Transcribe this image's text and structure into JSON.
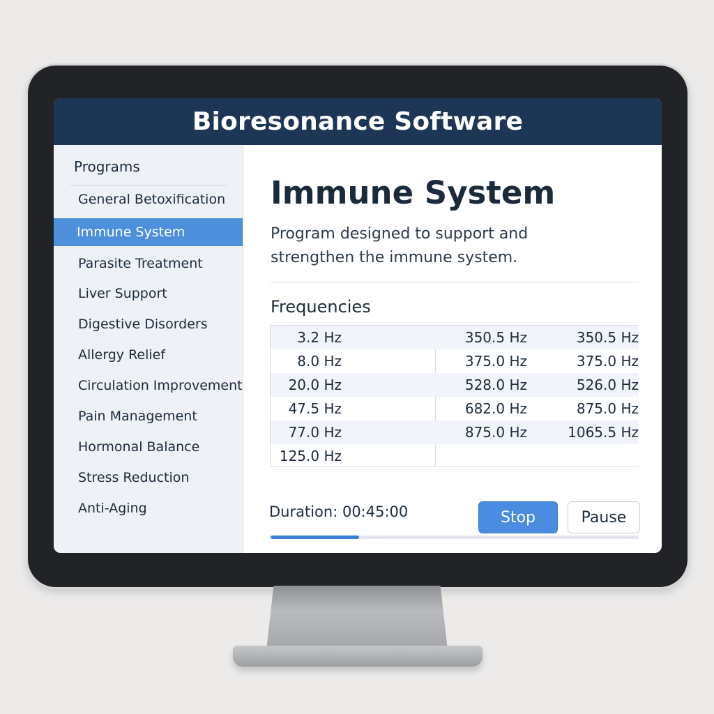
{
  "app": {
    "title": "Bioresonance Software"
  },
  "sidebar": {
    "heading": "Programs",
    "items": [
      {
        "label": "General Betoxification",
        "active": false
      },
      {
        "label": "Immune System",
        "active": true
      },
      {
        "label": "Parasite Treatment",
        "active": false
      },
      {
        "label": "Liver Support",
        "active": false
      },
      {
        "label": "Digestive Disorders",
        "active": false
      },
      {
        "label": "Allergy Relief",
        "active": false
      },
      {
        "label": "Circulation Improvement",
        "active": false
      },
      {
        "label": "Pain Management",
        "active": false
      },
      {
        "label": "Hormonal Balance",
        "active": false
      },
      {
        "label": "Stress Reduction",
        "active": false
      },
      {
        "label": "Anti-Aging",
        "active": false
      }
    ]
  },
  "program": {
    "title": "Immune System",
    "description": "Program designed to support and strengthen the immune system."
  },
  "frequencies": {
    "heading": "Frequencies",
    "rows": [
      [
        "3.2 Hz",
        "350.5 Hz",
        "350.5 Hz"
      ],
      [
        "8.0 Hz",
        "375.0 Hz",
        "375.0 Hz"
      ],
      [
        "20.0 Hz",
        "528.0 Hz",
        "526.0 Hz"
      ],
      [
        "47.5 Hz",
        "682.0 Hz",
        "875.0 Hz"
      ],
      [
        "77.0 Hz",
        "875.0 Hz",
        "1065.5 Hz"
      ],
      [
        "125.0 Hz",
        "",
        ""
      ]
    ]
  },
  "session": {
    "progress_fraction": 0.24,
    "duration_text": "Duration: 00:45:00",
    "stop_label": "Stop",
    "pause_label": "Pause"
  },
  "colors": {
    "header_bg": "#1e3656",
    "accent": "#4e8fdc",
    "sidebar_bg": "#eef1f5"
  }
}
